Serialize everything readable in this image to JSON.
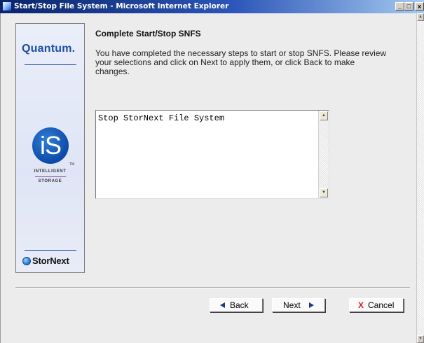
{
  "window": {
    "title": "Start/Stop File System - Microsoft Internet Explorer",
    "controls": {
      "minimize": "_",
      "maximize": "□",
      "close": "x"
    }
  },
  "brand": {
    "quantum": "Quantum.",
    "is_mark": "iS",
    "tm": "TM",
    "intelligent": "INTELLIGENT",
    "storage": "STORAGE",
    "stornext": "StorNext"
  },
  "content": {
    "heading": "Complete Start/Stop SNFS",
    "description": "You have completed the necessary steps to start or stop SNFS. Please review your selections and click on Next to apply them, or click Back to make changes.",
    "selection_text": "Stop StorNext File System"
  },
  "buttons": {
    "back": "Back",
    "next": "Next",
    "cancel": "Cancel",
    "cancel_glyph": "X"
  },
  "icons": {
    "app": "ie-page-icon",
    "back": "arrow-left-icon",
    "next": "arrow-right-icon",
    "cancel": "red-x-icon"
  }
}
